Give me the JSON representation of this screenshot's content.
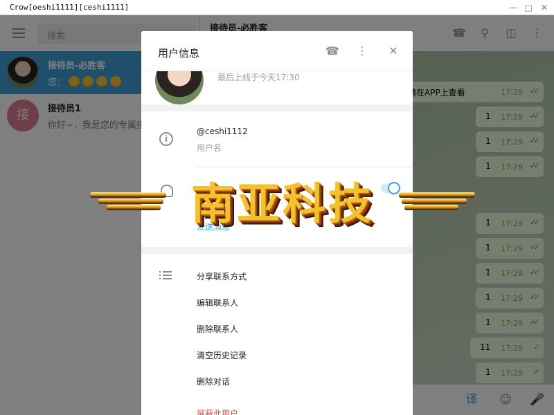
{
  "window": {
    "title": "Crow[oeshi1111][ceshi1111]"
  },
  "sidebar": {
    "search_placeholder": "搜索",
    "dialogs": [
      {
        "name": "接待员-必胜客",
        "preview": "您：",
        "emoji_count": 4,
        "active": true
      },
      {
        "name": "接待员1",
        "preview": "你好~，我是您的专属接",
        "avatar_letter": "接",
        "active": false
      }
    ]
  },
  "chat": {
    "peer_name": "接待员-必胜客",
    "messages": [
      {
        "text": "息，请在APP上查看",
        "time": "17:29",
        "read": true
      },
      {
        "text": "1",
        "time": "17:29",
        "read": true
      },
      {
        "text": "1",
        "time": "17:29",
        "read": true
      },
      {
        "text": "1",
        "time": "17:29",
        "read": true
      },
      {
        "text": "1",
        "time": "17:29",
        "read": true
      },
      {
        "text": "1",
        "time": "17:29",
        "read": true
      },
      {
        "text": "1",
        "time": "17:29",
        "read": true
      },
      {
        "text": "1",
        "time": "17:29",
        "read": true
      },
      {
        "text": "1",
        "time": "17:29",
        "read": true
      },
      {
        "text": "11",
        "time": "17:29",
        "read": false
      },
      {
        "text": "1",
        "time": "17:29",
        "read": false
      }
    ],
    "translate_label": "译"
  },
  "modal": {
    "title": "用户信息",
    "last_seen": "最后上线于今天17:30",
    "username": "@ceshi1112",
    "username_label": "用户名",
    "notifications_label": "发送消息",
    "notifications_on": true,
    "actions": [
      "分享联系方式",
      "编辑联系人",
      "删除联系人",
      "清空历史记录",
      "删除对话"
    ],
    "danger_action": "屏蔽此用户"
  },
  "watermark": {
    "text": "南亚科技"
  },
  "colors": {
    "accent": "#419fd9",
    "bubble": "#effdde",
    "danger": "#d14e4e"
  }
}
